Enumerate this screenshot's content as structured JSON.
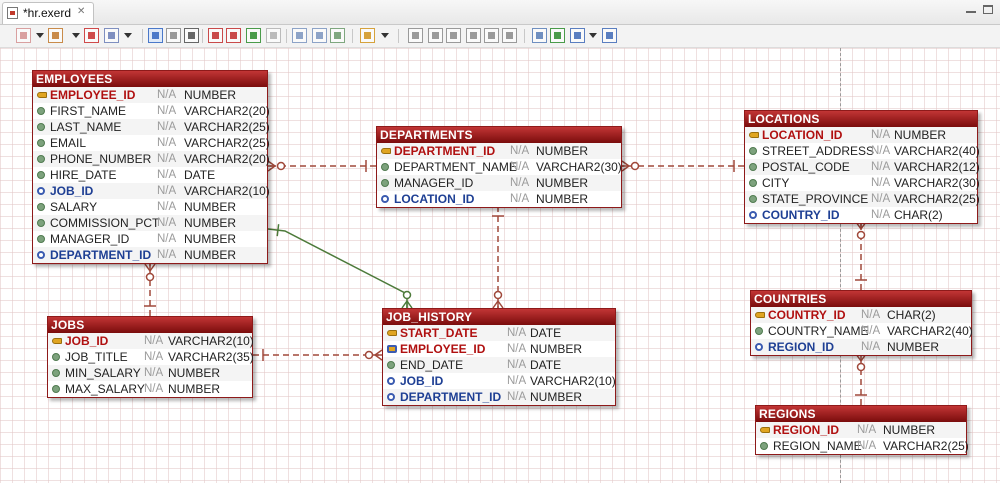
{
  "editor_tab": {
    "title": "*hr.exerd",
    "close_glyph": "✕"
  },
  "null_marker": "N/A",
  "toolbar": {
    "icons": [
      "palette-icon",
      "table-tool-icon",
      "note-tool-icon",
      "template-icon",
      "select-arrow-icon",
      "hand-tool-icon",
      "zoom-tool-icon",
      "entity-tool-icon",
      "relation-tool-icon",
      "identifying-relation-tool-icon",
      "comment-tool-icon",
      "import-db-icon",
      "export-db-icon",
      "image-icon",
      "format-icon",
      "align-left-icon",
      "align-center-icon",
      "align-right-icon",
      "align-top-icon",
      "align-middle-icon",
      "align-bottom-icon",
      "report-icon",
      "validate-icon",
      "generate-ddl-icon",
      "statistics-icon"
    ]
  },
  "tables": [
    {
      "id": "employees",
      "name": "EMPLOYEES",
      "columns": [
        {
          "name": "EMPLOYEE_ID",
          "key": "pk",
          "type": "NUMBER"
        },
        {
          "name": "FIRST_NAME",
          "key": "",
          "type": "VARCHAR2(20)"
        },
        {
          "name": "LAST_NAME",
          "key": "",
          "type": "VARCHAR2(25)"
        },
        {
          "name": "EMAIL",
          "key": "",
          "type": "VARCHAR2(25)"
        },
        {
          "name": "PHONE_NUMBER",
          "key": "",
          "type": "VARCHAR2(20)"
        },
        {
          "name": "HIRE_DATE",
          "key": "",
          "type": "DATE"
        },
        {
          "name": "JOB_ID",
          "key": "fk",
          "type": "VARCHAR2(10)"
        },
        {
          "name": "SALARY",
          "key": "",
          "type": "NUMBER"
        },
        {
          "name": "COMMISSION_PCT",
          "key": "",
          "type": "NUMBER"
        },
        {
          "name": "MANAGER_ID",
          "key": "",
          "type": "NUMBER"
        },
        {
          "name": "DEPARTMENT_ID",
          "key": "fk",
          "type": "NUMBER"
        }
      ]
    },
    {
      "id": "departments",
      "name": "DEPARTMENTS",
      "columns": [
        {
          "name": "DEPARTMENT_ID",
          "key": "pk",
          "type": "NUMBER"
        },
        {
          "name": "DEPARTMENT_NAME",
          "key": "",
          "type": "VARCHAR2(30)"
        },
        {
          "name": "MANAGER_ID",
          "key": "",
          "type": "NUMBER"
        },
        {
          "name": "LOCATION_ID",
          "key": "fk",
          "type": "NUMBER"
        }
      ]
    },
    {
      "id": "locations",
      "name": "LOCATIONS",
      "columns": [
        {
          "name": "LOCATION_ID",
          "key": "pk",
          "type": "NUMBER"
        },
        {
          "name": "STREET_ADDRESS",
          "key": "",
          "type": "VARCHAR2(40)"
        },
        {
          "name": "POSTAL_CODE",
          "key": "",
          "type": "VARCHAR2(12)"
        },
        {
          "name": "CITY",
          "key": "",
          "type": "VARCHAR2(30)"
        },
        {
          "name": "STATE_PROVINCE",
          "key": "",
          "type": "VARCHAR2(25)"
        },
        {
          "name": "COUNTRY_ID",
          "key": "fk",
          "type": "CHAR(2)"
        }
      ]
    },
    {
      "id": "jobs",
      "name": "JOBS",
      "columns": [
        {
          "name": "JOB_ID",
          "key": "pk",
          "type": "VARCHAR2(10)"
        },
        {
          "name": "JOB_TITLE",
          "key": "",
          "type": "VARCHAR2(35)"
        },
        {
          "name": "MIN_SALARY",
          "key": "",
          "type": "NUMBER"
        },
        {
          "name": "MAX_SALARY",
          "key": "",
          "type": "NUMBER"
        }
      ]
    },
    {
      "id": "job-history",
      "name": "JOB_HISTORY",
      "columns": [
        {
          "name": "START_DATE",
          "key": "pk",
          "type": "DATE"
        },
        {
          "name": "EMPLOYEE_ID",
          "key": "pkfk",
          "type": "NUMBER"
        },
        {
          "name": "END_DATE",
          "key": "",
          "type": "DATE"
        },
        {
          "name": "JOB_ID",
          "key": "fk",
          "type": "VARCHAR2(10)"
        },
        {
          "name": "DEPARTMENT_ID",
          "key": "fk",
          "type": "NUMBER"
        }
      ]
    },
    {
      "id": "countries",
      "name": "COUNTRIES",
      "columns": [
        {
          "name": "COUNTRY_ID",
          "key": "pk",
          "type": "CHAR(2)"
        },
        {
          "name": "COUNTRY_NAME",
          "key": "",
          "type": "VARCHAR2(40)"
        },
        {
          "name": "REGION_ID",
          "key": "fk",
          "type": "NUMBER"
        }
      ]
    },
    {
      "id": "regions",
      "name": "REGIONS",
      "columns": [
        {
          "name": "REGION_ID",
          "key": "pk",
          "type": "NUMBER"
        },
        {
          "name": "REGION_NAME",
          "key": "",
          "type": "VARCHAR2(25)"
        }
      ]
    }
  ],
  "relations": [
    {
      "id": "departments-employees",
      "parent": "departments",
      "child": "employees",
      "identifying": false
    },
    {
      "id": "locations-departments",
      "parent": "locations",
      "child": "departments",
      "identifying": false
    },
    {
      "id": "jobs-employees",
      "parent": "jobs",
      "child": "employees",
      "identifying": false
    },
    {
      "id": "jobs-job-history",
      "parent": "jobs",
      "child": "job-history",
      "identifying": false
    },
    {
      "id": "employees-job-history",
      "parent": "employees",
      "child": "job-history",
      "identifying": true
    },
    {
      "id": "departments-job-history",
      "parent": "departments",
      "child": "job-history",
      "identifying": false
    },
    {
      "id": "countries-locations",
      "parent": "countries",
      "child": "locations",
      "identifying": false
    },
    {
      "id": "regions-countries",
      "parent": "regions",
      "child": "countries",
      "identifying": false
    }
  ],
  "colors": {
    "header": "#9b1c1c",
    "pk_text": "#b01010",
    "fk_text": "#1e3f94",
    "non_identifying_line": "#a0483a",
    "identifying_line": "#4c7a3a",
    "grid": "#e2c6c6"
  }
}
